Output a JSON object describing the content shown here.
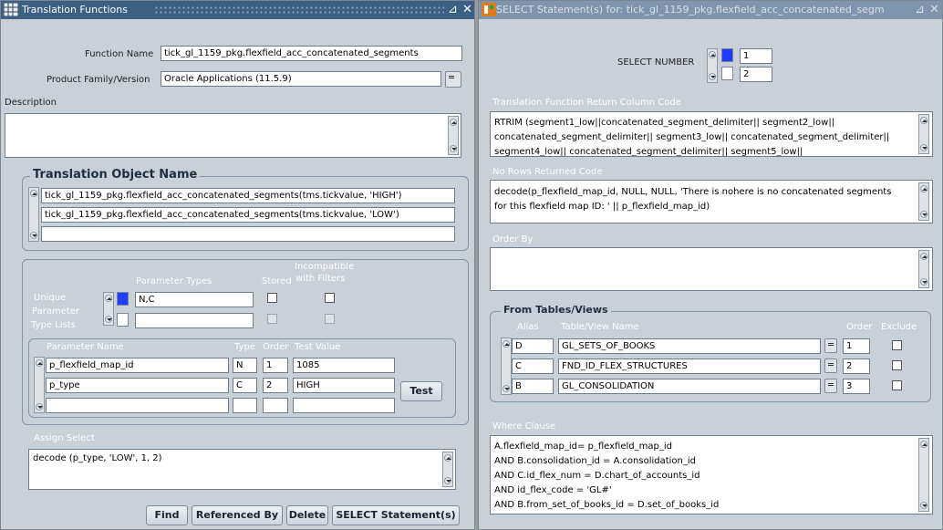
{
  "left_window": {
    "title": "Translation Functions",
    "function_name_label": "Function Name",
    "function_name_value": "tick_gl_1159_pkg.flexfield_acc_concatenated_segments",
    "product_family_label": "Product Family/Version",
    "product_family_value": "Oracle Applications (11.5.9)",
    "description_label": "Description",
    "description_value": "",
    "translation_object_title": "Translation Object Name",
    "translation_objects": [
      "tick_gl_1159_pkg.flexfield_acc_concatenated_segments(tms.tickvalue, 'HIGH')",
      "tick_gl_1159_pkg.flexfield_acc_concatenated_segments(tms.tickvalue, 'LOW')",
      ""
    ],
    "incompatible_label": "Incompatible",
    "with_filters_label": "with Filters",
    "parameter_types_label": "Parameter Types",
    "stored_label": "Stored",
    "unique_label_1": "Unique",
    "unique_label_2": "Parameter",
    "unique_label_3": "Type Lists",
    "parameter_type_lists": [
      {
        "value": "N,C",
        "stored": false,
        "incompatible": false
      },
      {
        "value": "",
        "stored": false,
        "incompatible": false
      }
    ],
    "params_header": {
      "name": "Parameter Name",
      "type": "Type",
      "order": "Order",
      "test_value": "Test Value"
    },
    "params": [
      {
        "name": "p_flexfield_map_id",
        "type": "N",
        "order": "1",
        "test_value": "1085"
      },
      {
        "name": "p_type",
        "type": "C",
        "order": "2",
        "test_value": "HIGH"
      },
      {
        "name": "",
        "type": "",
        "order": "",
        "test_value": ""
      }
    ],
    "test_button": "Test",
    "assign_select_label": "Assign Select",
    "assign_select_value": "decode (p_type, 'LOW', 1, 2)",
    "buttons": {
      "find": "Find",
      "referenced_by": "Referenced By",
      "delete": "Delete",
      "select_statements": "SELECT Statement(s)"
    }
  },
  "right_window": {
    "title": "SELECT Statement(s) for: tick_gl_1159_pkg.flexfield_acc_concatenated_segm",
    "select_number_label": "SELECT NUMBER",
    "select_numbers": [
      "1",
      "2"
    ],
    "return_column_label": "Translation Function Return Column Code",
    "return_column_lines": [
      "RTRIM (segment1_low||concatenated_segment_delimiter|| segment2_low||",
      "concatenated_segment_delimiter|| segment3_low|| concatenated_segment_delimiter||",
      "segment4_low|| concatenated_segment_delimiter|| segment5_low||"
    ],
    "no_rows_label": "No Rows Returned Code",
    "no_rows_lines": [
      "decode(p_flexfield_map_id, NULL, NULL, 'There is nohere is no concatenated segments",
      "for this flexfield map ID: ' || p_flexfield_map_id)"
    ],
    "order_by_label": "Order By",
    "order_by_value": "",
    "from_tables_title": "From Tables/Views",
    "tables_header": {
      "alias": "Alias",
      "name": "Table/View Name",
      "order": "Order",
      "exclude": "Exclude"
    },
    "tables": [
      {
        "alias": "D",
        "name": "GL_SETS_OF_BOOKS",
        "order": "1",
        "exclude": false
      },
      {
        "alias": "C",
        "name": "FND_ID_FLEX_STRUCTURES",
        "order": "2",
        "exclude": false
      },
      {
        "alias": "B",
        "name": "GL_CONSOLIDATION",
        "order": "3",
        "exclude": false
      }
    ],
    "where_clause_label": "Where Clause",
    "where_clause_lines": [
      "A.flexfield_map_id= p_flexfield_map_id",
      "AND B.consolidation_id = A.consolidation_id",
      "AND C.id_flex_num = D.chart_of_accounts_id",
      "AND id_flex_code = 'GL#'",
      "AND B.from_set_of_books_id = D.set_of_books_id"
    ]
  },
  "colors": {
    "title_active": "#3c5f84",
    "title_inactive": "#7f95ad",
    "window_bg": "#c9d0d8",
    "current_record": "#1f3cff"
  }
}
